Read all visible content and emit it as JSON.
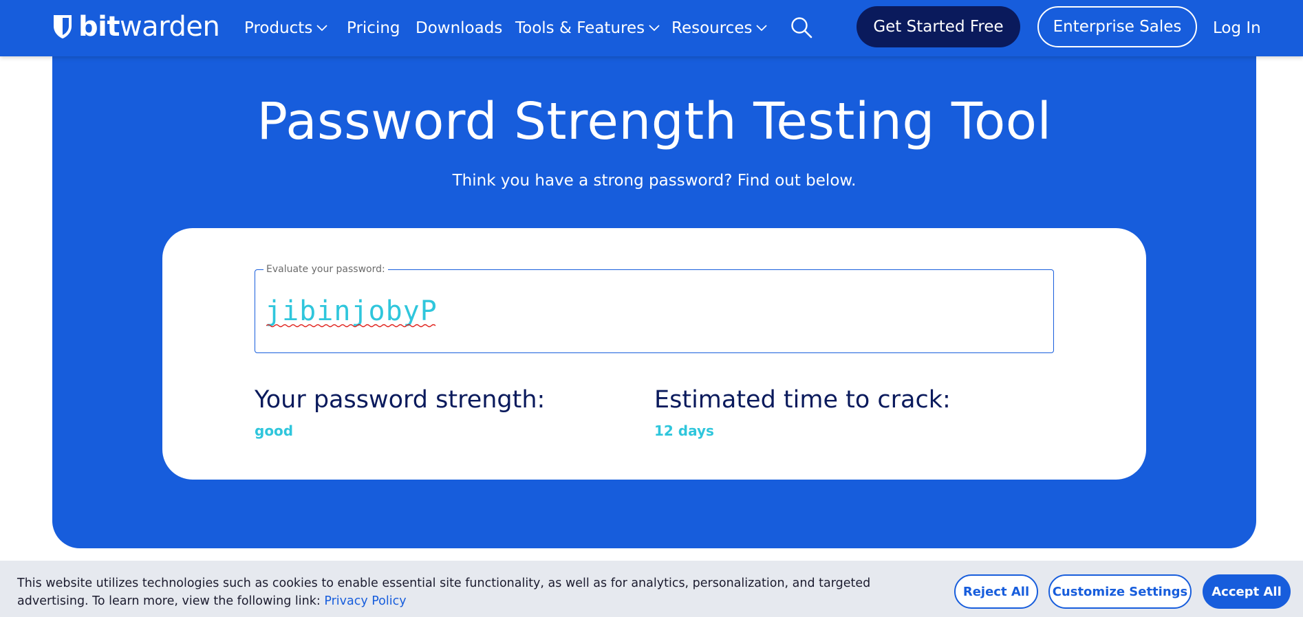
{
  "nav": {
    "logo": {
      "bold": "bit",
      "regular": "warden"
    },
    "items": [
      {
        "label": "Products",
        "dropdown": true
      },
      {
        "label": "Pricing",
        "dropdown": false
      },
      {
        "label": "Downloads",
        "dropdown": false
      },
      {
        "label": "Tools & Features",
        "dropdown": true
      },
      {
        "label": "Resources",
        "dropdown": true
      }
    ],
    "search_icon": "search-icon",
    "get_started_label": "Get Started Free",
    "enterprise_label": "Enterprise Sales",
    "login_label": "Log In"
  },
  "hero": {
    "title": "Password Strength Testing Tool",
    "subtitle": "Think you have a strong password? Find out below."
  },
  "evaluator": {
    "field_label": "Evaluate your password:",
    "input_value": "jibinjobyP",
    "strength_label": "Your password strength:",
    "strength_value": "good",
    "crack_label": "Estimated time to crack:",
    "crack_value": "12 days"
  },
  "cookie_banner": {
    "text": "This website utilizes technologies such as cookies to enable essential site functionality, as well as for analytics, personalization, and targeted advertising. To learn more, view the following link:",
    "link_label": "Privacy Policy",
    "reject_label": "Reject All",
    "customize_label": "Customize Settings",
    "accept_label": "Accept All"
  },
  "colors": {
    "brand_blue": "#175ddc",
    "navy": "#0a1a5c",
    "result_cyan": "#2fc6dc",
    "banner_bg": "#e6e9ef"
  }
}
